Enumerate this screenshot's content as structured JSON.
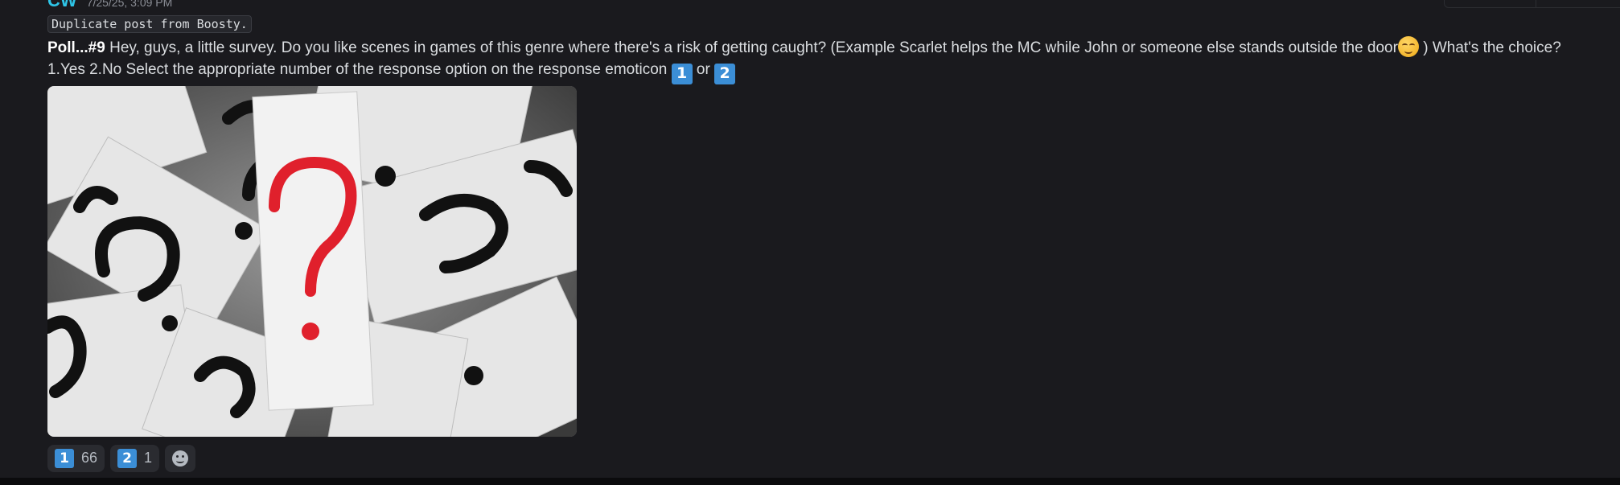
{
  "message": {
    "author": "CW",
    "timestamp": "7/25/25, 3:09 PM",
    "code_tag": "Duplicate post from Boosty.",
    "bold_prefix": "Poll...#9",
    "text_part1": " Hey, guys, a little survey. Do you like scenes in games of this genre where there's a risk of getting caught? (Example Scarlet helps the MC while John or someone else stands outside the door",
    "text_part2": " ) What's the choice? 1.Yes 2.No Select the appropriate number of the response option on the response emoticon ",
    "text_or": " or ",
    "keycap_1": "1",
    "keycap_2": "2",
    "inline_emoji": "smiling-face-with-blush-icon",
    "attachment": {
      "subject": "question marks printed on paper cards, one red",
      "accent_color": "#e0202c"
    }
  },
  "reactions": [
    {
      "emoji": "1",
      "count": "66"
    },
    {
      "emoji": "2",
      "count": "1"
    }
  ],
  "colors": {
    "background": "#1a1a1e",
    "author": "#2ec4e6",
    "keycap": "#3b8ed6",
    "reaction_bg": "#2a2b30"
  }
}
